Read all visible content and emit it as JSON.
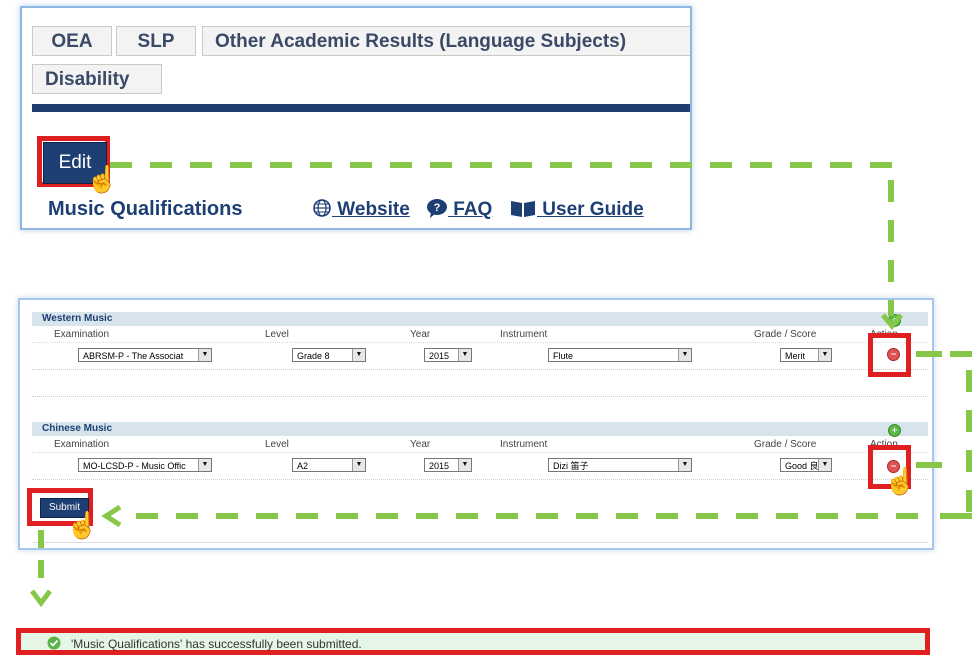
{
  "tabs": [
    "OEA",
    "SLP",
    "Other Academic Results (Language Subjects)",
    "Disability"
  ],
  "edit_label": "Edit",
  "header": {
    "title": "Music Qualifications",
    "website": "Website",
    "faq": "FAQ",
    "user_guide": "User Guide"
  },
  "columns": [
    "Examination",
    "Level",
    "Year",
    "Instrument",
    "Grade / Score",
    "Action"
  ],
  "sections": [
    {
      "title": "Western Music",
      "row": {
        "examination": "ABRSM-P - The Associat",
        "level": "Grade 8",
        "year": "2015",
        "instrument": "Flute",
        "grade": "Merit"
      }
    },
    {
      "title": "Chinese Music",
      "row": {
        "examination": "MO-LCSD-P - Music Offic",
        "level": "A2",
        "year": "2015",
        "instrument": "Dizi 笛子",
        "grade": "Good 良"
      }
    }
  ],
  "submit_label": "Submit",
  "success_message": "'Music Qualifications' has successfully been submitted.",
  "colors": {
    "highlight": "#e02020",
    "arrow": "#86c648",
    "button": "#1e3f73"
  }
}
